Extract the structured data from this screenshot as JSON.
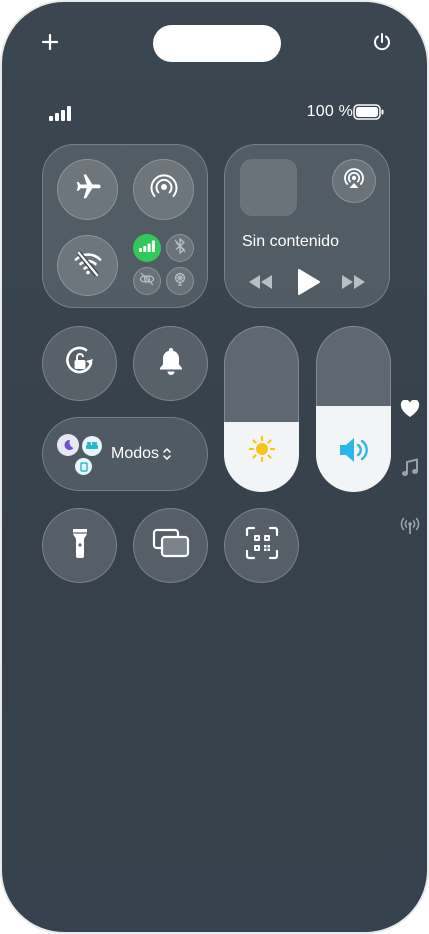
{
  "topbar": {
    "add_icon": "plus-icon",
    "power_icon": "power-icon"
  },
  "status": {
    "battery_text": "100 %"
  },
  "connectivity": {
    "icons": [
      "airplane-icon",
      "airdrop-icon",
      "wifi-off-icon",
      "cellular-data-icon",
      "bluetooth-icon",
      "vpn-icon",
      "satellite-icon"
    ],
    "cellular_active_color": "#32c95a"
  },
  "media": {
    "title": "Sin contenido",
    "icons": [
      "airplay-icon",
      "rewind-icon",
      "play-icon",
      "fast-forward-icon"
    ]
  },
  "controls": {
    "brightness_level": 0.42,
    "volume_level": 0.52,
    "modos_label": "Modos"
  },
  "side": {
    "icons": [
      "heart-icon",
      "music-note-icon",
      "broadcast-icon"
    ]
  },
  "colors": {
    "background": "#38434d",
    "accent_yellow": "#f5c518",
    "accent_blue": "#2bb6e6"
  }
}
